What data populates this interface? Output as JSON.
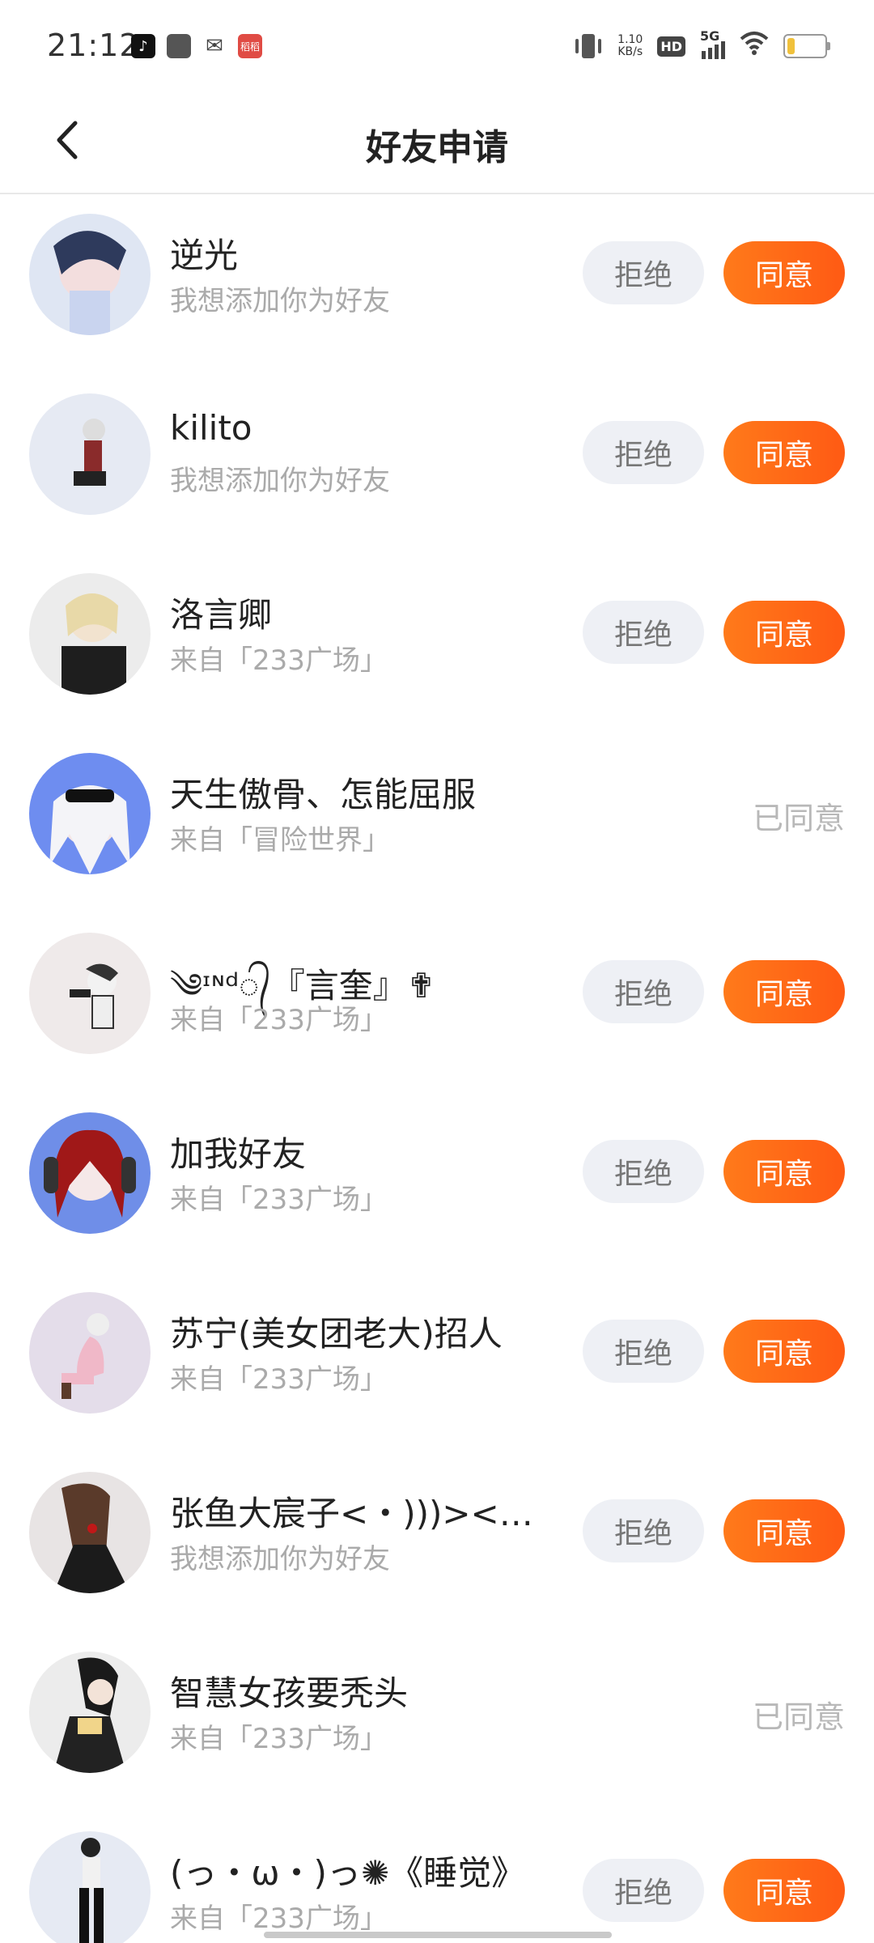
{
  "status_bar": {
    "time": "21:12",
    "net_speed_value": "1.10",
    "net_speed_unit": "KB/s",
    "hd_label": "HD",
    "signal_label": "5G",
    "red_app_label": "稻稻",
    "battery_level": 0.2
  },
  "header": {
    "title": "好友申请"
  },
  "labels": {
    "reject": "拒绝",
    "accept": "同意",
    "agreed": "已同意"
  },
  "requests": [
    {
      "name": "逆光",
      "subtitle": "我想添加你为好友",
      "status": "pending"
    },
    {
      "name": "kilito",
      "subtitle": "我想添加你为好友",
      "status": "pending"
    },
    {
      "name": "洛言卿",
      "subtitle": "来自「233广场」",
      "status": "pending"
    },
    {
      "name": "天生傲骨、怎能屈服",
      "subtitle": "来自「冒险世界」",
      "status": "agreed"
    },
    {
      "name": "༄ᶦᶰᵈ᭄『言奎』✟",
      "subtitle": "来自「233广场」",
      "status": "pending"
    },
    {
      "name": "加我好友",
      "subtitle": "来自「233广场」",
      "status": "pending"
    },
    {
      "name": "苏宁(美女团老大)招人",
      "subtitle": "来自「233广场」",
      "status": "pending"
    },
    {
      "name": "张鱼大宸子<・)))><…",
      "subtitle": "我想添加你为好友",
      "status": "pending"
    },
    {
      "name": "智慧女孩要秃头",
      "subtitle": "来自「233广场」",
      "status": "agreed"
    },
    {
      "name": "(っ・ω・)っ✺《睡觉》",
      "subtitle": "来自「233广场」",
      "status": "pending"
    }
  ]
}
